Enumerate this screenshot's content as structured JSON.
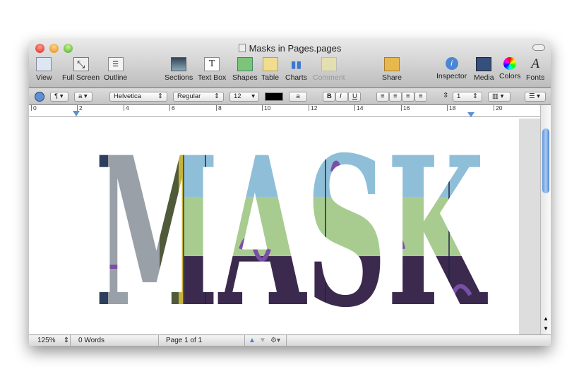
{
  "window": {
    "title": "Masks in Pages.pages"
  },
  "toolbar": {
    "view": "View",
    "full_screen": "Full Screen",
    "outline": "Outline",
    "sections": "Sections",
    "text_box": "Text Box",
    "shapes": "Shapes",
    "table": "Table",
    "charts": "Charts",
    "comment": "Comment",
    "share": "Share",
    "inspector": "Inspector",
    "media": "Media",
    "colors": "Colors",
    "fonts": "Fonts"
  },
  "format_bar": {
    "paragraph_style": "¶",
    "char_style": "a",
    "font": "Helvetica",
    "typeface": "Regular",
    "size": "12",
    "bold": "B",
    "italic": "I",
    "underline": "U",
    "line_spacing": "1"
  },
  "ruler": {
    "ticks": [
      "0",
      "2",
      "4",
      "6",
      "8",
      "10",
      "12",
      "14",
      "16",
      "18",
      "20"
    ]
  },
  "document": {
    "mask_text": "MASK"
  },
  "status": {
    "zoom": "125%",
    "words": "0 Words",
    "page": "Page 1 of 1"
  },
  "colors": {
    "band_top": "#8fbfd8",
    "band_mid": "#a8cc90",
    "band_bottom": "#3b2a4e",
    "left_strip": "#2d3f5c"
  }
}
